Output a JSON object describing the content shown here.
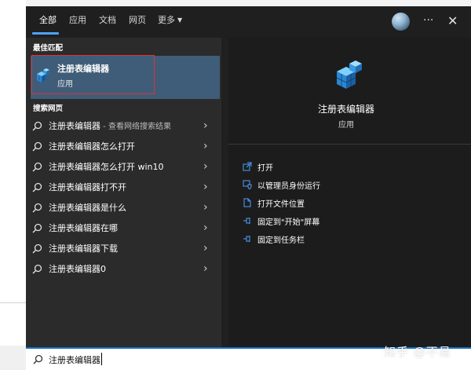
{
  "tabs": [
    {
      "label": "全部",
      "active": true
    },
    {
      "label": "应用",
      "active": false
    },
    {
      "label": "文档",
      "active": false
    },
    {
      "label": "网页",
      "active": false
    },
    {
      "label": "更多",
      "active": false
    }
  ],
  "header": {
    "more_menu_icon": "ellipsis-icon",
    "close_icon": "close-icon",
    "ellipsis": "···",
    "close": "✕"
  },
  "best_match": {
    "section_label": "最佳匹配",
    "title": "注册表编辑器",
    "subtitle": "应用"
  },
  "web_search": {
    "section_label": "搜索网页",
    "results": [
      {
        "text": "注册表编辑器",
        "suffix": " - 查看网络搜索结果"
      },
      {
        "text": "注册表编辑器怎么打开",
        "suffix": ""
      },
      {
        "text": "注册表编辑器怎么打开 win10",
        "suffix": ""
      },
      {
        "text": "注册表编辑器打不开",
        "suffix": ""
      },
      {
        "text": "注册表编辑器是什么",
        "suffix": ""
      },
      {
        "text": "注册表编辑器在哪",
        "suffix": ""
      },
      {
        "text": "注册表编辑器下载",
        "suffix": ""
      },
      {
        "text": "注册表编辑器0",
        "suffix": ""
      }
    ]
  },
  "preview": {
    "title": "注册表编辑器",
    "subtitle": "应用",
    "actions": [
      {
        "label": "打开",
        "icon": "open-icon"
      },
      {
        "label": "以管理员身份运行",
        "icon": "run-as-admin-icon"
      },
      {
        "label": "打开文件位置",
        "icon": "file-location-icon"
      },
      {
        "label": "固定到\"开始\"屏幕",
        "icon": "pin-icon"
      },
      {
        "label": "固定到任务栏",
        "icon": "pin-icon"
      }
    ]
  },
  "search_box": {
    "value": "注册表编辑器"
  },
  "watermark": "知乎 @不易",
  "colors": {
    "accent": "#4ea1ff",
    "selected_bg": "#3f5d78",
    "highlight_outline": "#e0303a"
  }
}
